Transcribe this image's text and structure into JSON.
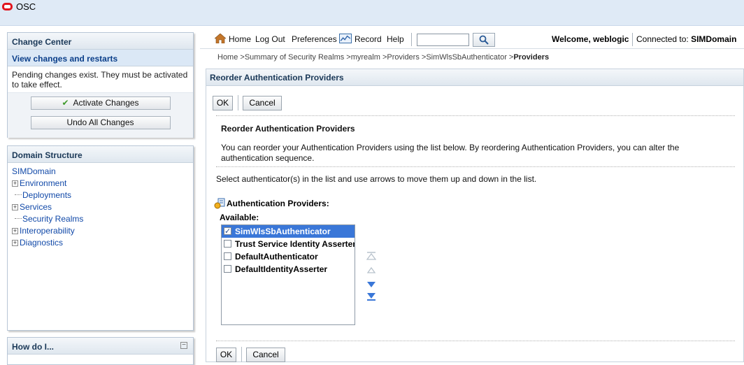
{
  "app": {
    "title": "OSC"
  },
  "change_center": {
    "title": "Change Center",
    "link": "View changes and restarts",
    "message": "Pending changes exist. They must be activated to take effect.",
    "activate_label": "Activate Changes",
    "undo_label": "Undo All Changes"
  },
  "domain_structure": {
    "title": "Domain Structure",
    "root": "SIMDomain",
    "items": [
      {
        "label": "Environment",
        "expandable": true
      },
      {
        "label": "Deployments",
        "expandable": false
      },
      {
        "label": "Services",
        "expandable": true
      },
      {
        "label": "Security Realms",
        "expandable": false
      },
      {
        "label": "Interoperability",
        "expandable": true
      },
      {
        "label": "Diagnostics",
        "expandable": true
      }
    ]
  },
  "how_do_i": {
    "title": "How do I..."
  },
  "nav": {
    "home": "Home",
    "logout": "Log Out",
    "preferences": "Preferences",
    "record": "Record",
    "help": "Help",
    "search_value": "",
    "welcome": "Welcome, weblogic",
    "connected_label": "Connected to:",
    "connected_domain": "SIMDomain"
  },
  "breadcrumb": {
    "path": "Home >Summary of Security Realms >myrealm >Providers >SimWlsSbAuthenticator >",
    "current": "Providers"
  },
  "main": {
    "panel_title": "Reorder Authentication Providers",
    "ok_label": "OK",
    "cancel_label": "Cancel",
    "section_title": "Reorder Authentication Providers",
    "description": "You can reorder your Authentication Providers using the list below. By reordering Authentication Providers, you can alter the authentication sequence.",
    "instruction": "Select authenticator(s) in the list and use arrows to move them up and down in the list.",
    "providers_label": "Authentication Providers:",
    "available_label": "Available:",
    "providers": [
      {
        "name": "SimWlsSbAuthenticator",
        "checked": true,
        "selected": true
      },
      {
        "name": "Trust Service Identity Asserter",
        "checked": false,
        "selected": false
      },
      {
        "name": "DefaultAuthenticator",
        "checked": false,
        "selected": false
      },
      {
        "name": "DefaultIdentityAsserter",
        "checked": false,
        "selected": false
      }
    ]
  },
  "colors": {
    "accent": "#3a77d8",
    "link": "#1149a8",
    "logo": "#e1141e",
    "banner": "#dfeaf6"
  }
}
